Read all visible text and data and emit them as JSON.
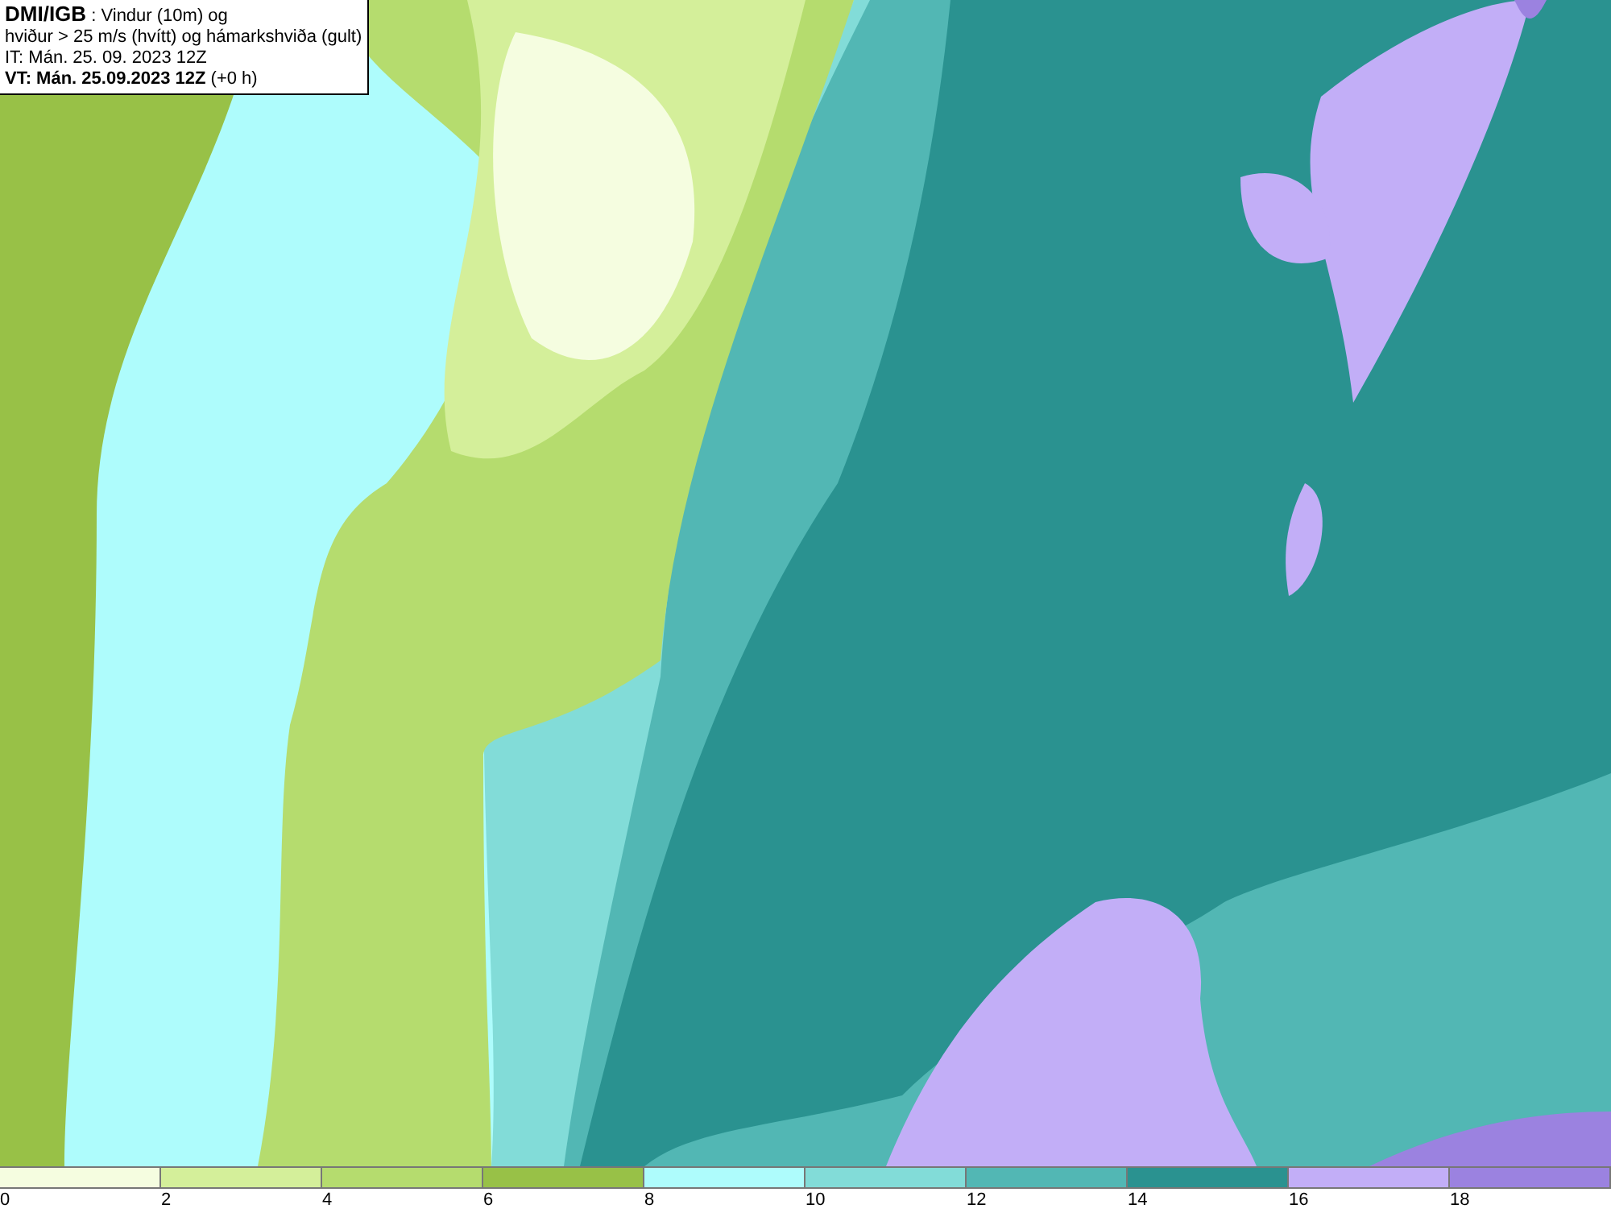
{
  "title_box": {
    "lines": [
      "**DMI/IGB** : Vindur (10m) og",
      "hviður > 25 m/s (hvítt) og hámarkshviða (gult)",
      "IT: Mán. 25. 09. 2023 12Z",
      "**VT: Mán. 25.09.2023 12Z** (+0 h)"
    ]
  },
  "legend": [
    {
      "label": "0",
      "color": "#f5fde0"
    },
    {
      "label": "2",
      "color": "#d4ef9a"
    },
    {
      "label": "4",
      "color": "#b5dc6e"
    },
    {
      "label": "6",
      "color": "#98c147"
    },
    {
      "label": "8",
      "color": "#aefcfc"
    },
    {
      "label": "10",
      "color": "#82dcd8"
    },
    {
      "label": "12",
      "color": "#52b7b4"
    },
    {
      "label": "14",
      "color": "#2a9290"
    },
    {
      "label": "16",
      "color": "#c2aef7"
    },
    {
      "label": "18",
      "color": "#9b82e0"
    }
  ]
}
